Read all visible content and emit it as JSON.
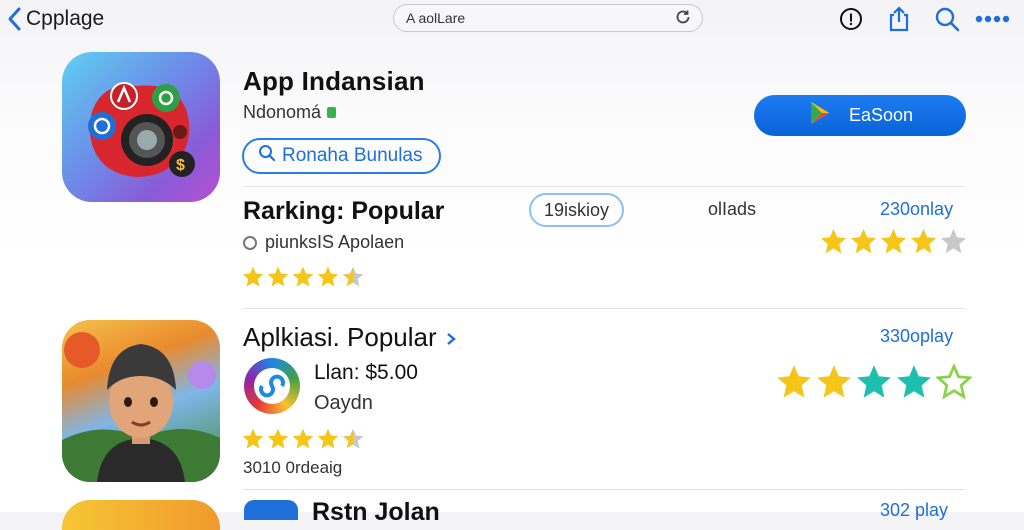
{
  "topbar": {
    "back_label": "Cpplage",
    "url_text": "A aolLare",
    "icons": [
      "chevron-left-icon",
      "reload-icon",
      "info-icon",
      "share-icon",
      "search-icon",
      "more-icon"
    ]
  },
  "app": {
    "title": "App Indansian",
    "subtitle": "Ndonomá",
    "pill_label": "Ronaha Bunulas",
    "get_button_label": "EaSoon",
    "accent": "#0a6fe5"
  },
  "row1": {
    "title": "Rarking: Popular",
    "subtitle": "piunksIS Apolaen",
    "chip_label": "19iskioy",
    "meta": "olIads",
    "link": "230onlay",
    "rating_left": 4.5,
    "rating_right": 4
  },
  "row2": {
    "title": "Aplkiasi. Popular",
    "price": "Llan: $5.00",
    "developer": "Oaydn",
    "footer": "3010 0rdeaig",
    "link": "330oplay",
    "rating_left": 4.5,
    "rating_right": 4
  },
  "row3": {
    "title": "Rstn Jolan",
    "link": "302 play"
  },
  "colors": {
    "star_gold": "#f5c518",
    "star_teal": "#1fbfb0",
    "star_empty": "#c8c8c8",
    "blue": "#1e6fd9"
  }
}
